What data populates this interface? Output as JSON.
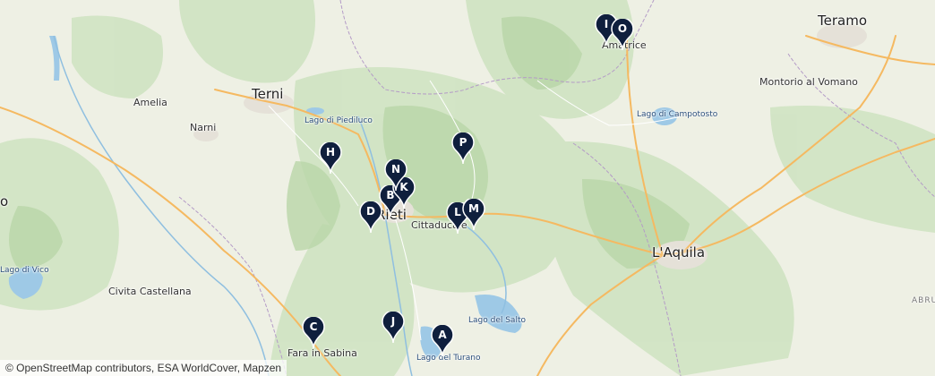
{
  "map": {
    "labels": {
      "teramo": "Teramo",
      "amatrice": "Amatrice",
      "terni": "Terni",
      "amelia": "Amelia",
      "narni": "Narni",
      "lago_piediluco": "Lago di Piediluco",
      "montorio": "Montorio al Vomano",
      "lago_campotosto": "Lago di Campotosto",
      "rieti": "Rieti",
      "cittaducale": "Cittaducale",
      "laquila": "L'Aquila",
      "lago_vico": "Lago di Vico",
      "civita": "Civita Castellana",
      "lago_salto": "Lago del Salto",
      "fara": "Fara in Sabina",
      "lago_turano": "Lago del Turano",
      "abruzzo": "ABRUZZ",
      "partial_o": "o"
    },
    "markers": [
      "A",
      "B",
      "C",
      "D",
      "H",
      "I",
      "J",
      "K",
      "L",
      "M",
      "N",
      "O",
      "P"
    ],
    "attribution": "© OpenStreetMap contributors, ESA WorldCover, Mapzen",
    "colors": {
      "marker": "#0f1f3d",
      "water": "#9ec9e6",
      "highway": "#f5b961",
      "terrain": "#cfe3c2",
      "terrain_dark": "#b9d6a8"
    }
  }
}
